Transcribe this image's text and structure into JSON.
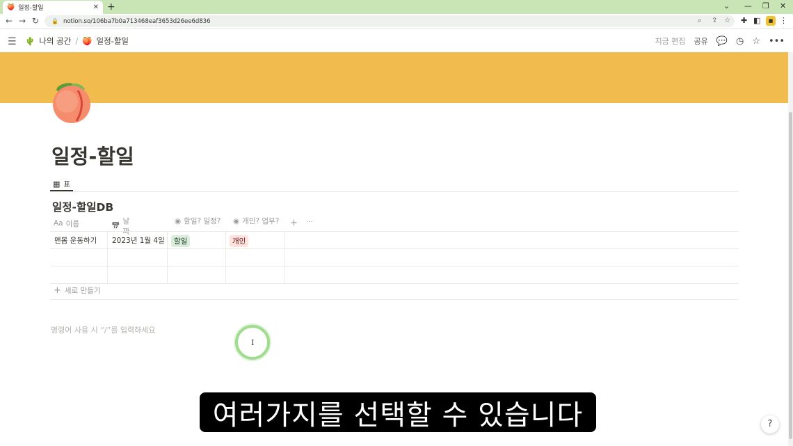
{
  "browser": {
    "tab_title": "일정-할일",
    "tab_favicon": "🍑",
    "new_tab": "+",
    "url": "notion.so/106ba7b0a713468eaf3653d26ee6d836"
  },
  "notion_top": {
    "breadcrumb_workspace": "나의 공간",
    "breadcrumb_workspace_icon": "🌵",
    "breadcrumb_separator": "/",
    "breadcrumb_page": "일정-할일",
    "breadcrumb_page_icon": "🍑",
    "edited": "지금 편집",
    "share": "공유"
  },
  "page": {
    "cover_color": "#f2bb4e",
    "title": "일정-할일",
    "view_tab": "표",
    "db_title": "일정-할일DB",
    "columns": [
      {
        "icon": "Aa",
        "label": "이름"
      },
      {
        "icon": "📅",
        "label": "날짜"
      },
      {
        "icon": "◉",
        "label": "할일? 일정?"
      },
      {
        "icon": "◉",
        "label": "개인? 업무?"
      }
    ],
    "add_column": "+",
    "more": "···",
    "rows": [
      {
        "name": "맨몸 운동하기",
        "date": "2023년 1월 4일",
        "type": "할일",
        "type_color": "#dbeddb",
        "category": "개인",
        "category_color": "#ffe2dd"
      }
    ],
    "new_row": "새로 만들기",
    "placeholder": "명령어 사용 시 “/”를 입력하세요"
  },
  "subtitle": "여러가지를 선택할 수 있습니다",
  "help": "?"
}
